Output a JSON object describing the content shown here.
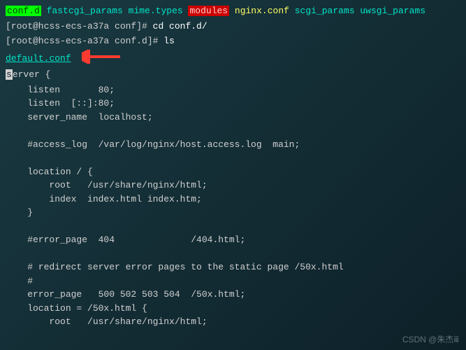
{
  "ls_items": [
    {
      "text": "conf.d",
      "style": "highlight-green"
    },
    {
      "text": "fastcgi_params",
      "style": "teal"
    },
    {
      "text": "mime.types",
      "style": "teal"
    },
    {
      "text": "modules",
      "style": "highlight-red"
    },
    {
      "text": "nginx.conf",
      "style": "yellow"
    },
    {
      "text": "scgi_params",
      "style": "teal"
    },
    {
      "text": "uwsgi_params",
      "style": "teal"
    }
  ],
  "prompt1": {
    "prefix": "[root@hcss-ecs-a37a conf]# ",
    "command": "cd conf.d/"
  },
  "prompt2": {
    "prefix": "[root@hcss-ecs-a37a conf.d]# ",
    "command": "ls"
  },
  "filename": "default.conf",
  "cursor_char": "s",
  "config_first_line": "erver {",
  "config_body": "    listen       80;\n    listen  [::]:80;\n    server_name  localhost;\n\n    #access_log  /var/log/nginx/host.access.log  main;\n\n    location / {\n        root   /usr/share/nginx/html;\n        index  index.html index.htm;\n    }\n\n    #error_page  404              /404.html;\n\n    # redirect server error pages to the static page /50x.html\n    #\n    error_page   500 502 503 504  /50x.html;\n    location = /50x.html {\n        root   /usr/share/nginx/html;",
  "watermark": "CSDN @朱杰ⅲ"
}
